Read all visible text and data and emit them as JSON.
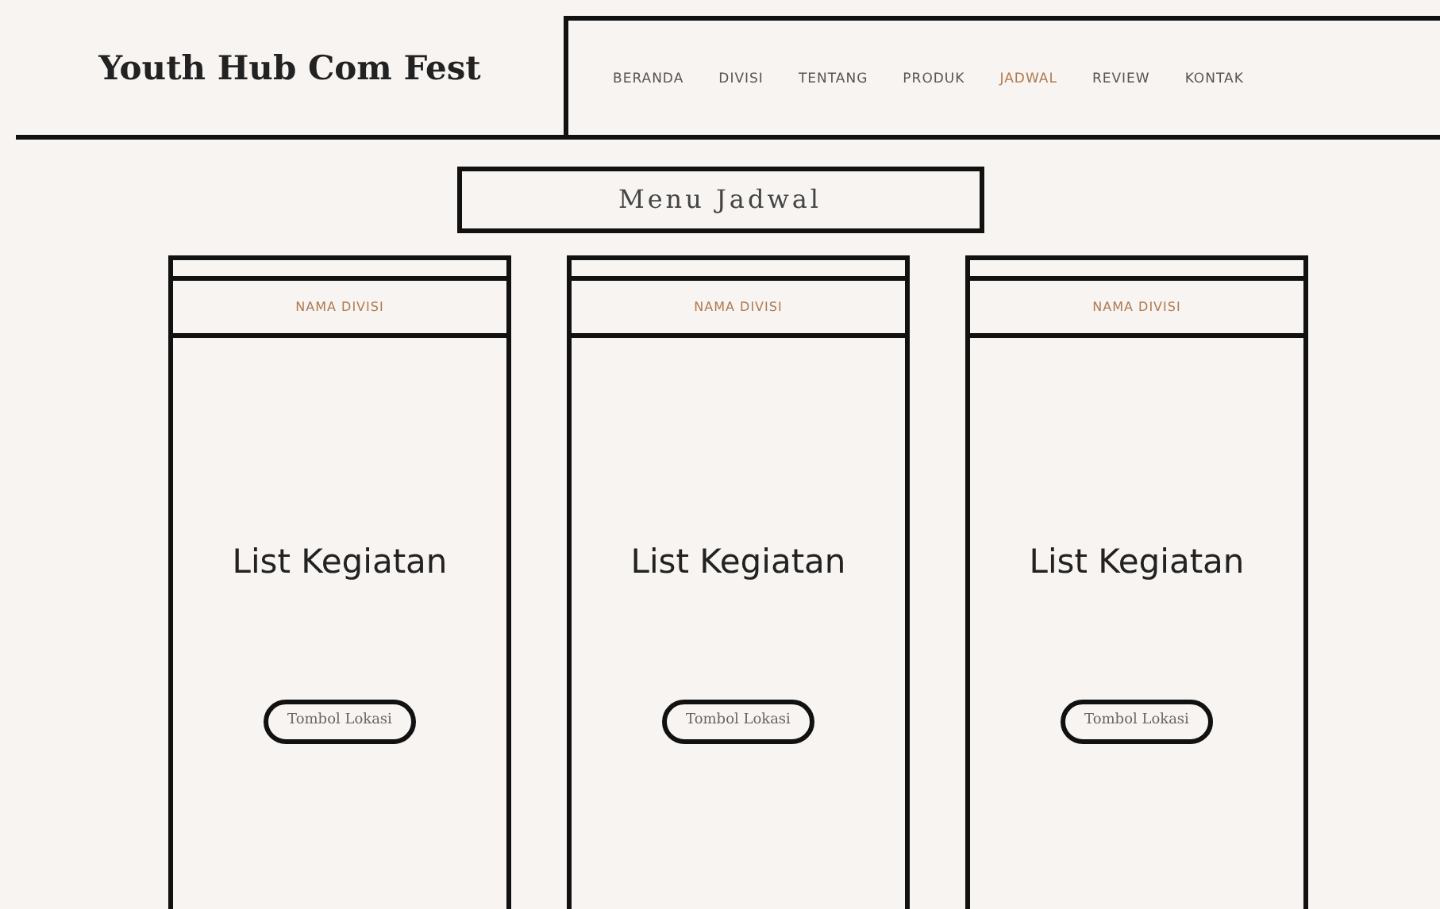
{
  "header": {
    "brand": "Youth Hub Com Fest",
    "nav": [
      {
        "label": "BERANDA",
        "selected": false
      },
      {
        "label": "DIVISI",
        "selected": false
      },
      {
        "label": "TENTANG",
        "selected": false
      },
      {
        "label": "PRODUK",
        "selected": false
      },
      {
        "label": "JADWAL",
        "selected": true
      },
      {
        "label": "REVIEW",
        "selected": false
      },
      {
        "label": "KONTAK",
        "selected": false
      }
    ]
  },
  "section_title": "Menu Jadwal",
  "cards": [
    {
      "division": "NAMA DIVISI",
      "body": "List Kegiatan",
      "button": "Tombol Lokasi"
    },
    {
      "division": "NAMA DIVISI",
      "body": "List Kegiatan",
      "button": "Tombol Lokasi"
    },
    {
      "division": "NAMA DIVISI",
      "body": "List Kegiatan",
      "button": "Tombol Lokasi"
    }
  ]
}
